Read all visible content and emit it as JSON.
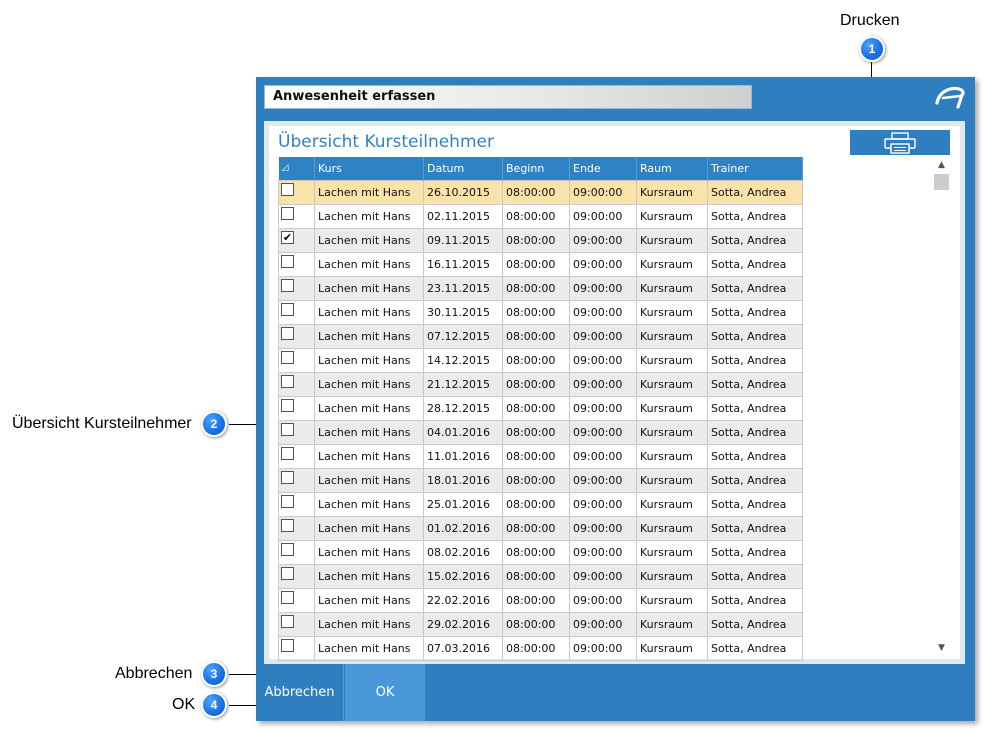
{
  "annotations": [
    {
      "number": "1",
      "label": "Drucken"
    },
    {
      "number": "2",
      "label": "Übersicht Kursteilnehmer"
    },
    {
      "number": "3",
      "label": "Abbrechen"
    },
    {
      "number": "4",
      "label": "OK"
    }
  ],
  "dialog": {
    "title": "Anwesenheit erfassen",
    "panel_title": "Übersicht Kursteilnehmer",
    "icons": {
      "logo": "app-logo-icon",
      "print": "printer-icon",
      "sort": "sort-indicator-icon"
    },
    "colors": {
      "frame": "#2f7fc0",
      "header": "#2f83c5",
      "selected_row": "#fae3a8",
      "alt_row": "#ebebeb"
    }
  },
  "table": {
    "columns": [
      "Kurs",
      "Datum",
      "Beginn",
      "Ende",
      "Raum",
      "Trainer"
    ],
    "rows": [
      {
        "checked": false,
        "kurs": "Lachen mit Hans",
        "datum": "26.10.2015",
        "beginn": "08:00:00",
        "ende": "09:00:00",
        "raum": "Kursraum",
        "trainer": "Sotta, Andrea"
      },
      {
        "checked": false,
        "kurs": "Lachen mit Hans",
        "datum": "02.11.2015",
        "beginn": "08:00:00",
        "ende": "09:00:00",
        "raum": "Kursraum",
        "trainer": "Sotta, Andrea"
      },
      {
        "checked": true,
        "kurs": "Lachen mit Hans",
        "datum": "09.11.2015",
        "beginn": "08:00:00",
        "ende": "09:00:00",
        "raum": "Kursraum",
        "trainer": "Sotta, Andrea"
      },
      {
        "checked": false,
        "kurs": "Lachen mit Hans",
        "datum": "16.11.2015",
        "beginn": "08:00:00",
        "ende": "09:00:00",
        "raum": "Kursraum",
        "trainer": "Sotta, Andrea"
      },
      {
        "checked": false,
        "kurs": "Lachen mit Hans",
        "datum": "23.11.2015",
        "beginn": "08:00:00",
        "ende": "09:00:00",
        "raum": "Kursraum",
        "trainer": "Sotta, Andrea"
      },
      {
        "checked": false,
        "kurs": "Lachen mit Hans",
        "datum": "30.11.2015",
        "beginn": "08:00:00",
        "ende": "09:00:00",
        "raum": "Kursraum",
        "trainer": "Sotta, Andrea"
      },
      {
        "checked": false,
        "kurs": "Lachen mit Hans",
        "datum": "07.12.2015",
        "beginn": "08:00:00",
        "ende": "09:00:00",
        "raum": "Kursraum",
        "trainer": "Sotta, Andrea"
      },
      {
        "checked": false,
        "kurs": "Lachen mit Hans",
        "datum": "14.12.2015",
        "beginn": "08:00:00",
        "ende": "09:00:00",
        "raum": "Kursraum",
        "trainer": "Sotta, Andrea"
      },
      {
        "checked": false,
        "kurs": "Lachen mit Hans",
        "datum": "21.12.2015",
        "beginn": "08:00:00",
        "ende": "09:00:00",
        "raum": "Kursraum",
        "trainer": "Sotta, Andrea"
      },
      {
        "checked": false,
        "kurs": "Lachen mit Hans",
        "datum": "28.12.2015",
        "beginn": "08:00:00",
        "ende": "09:00:00",
        "raum": "Kursraum",
        "trainer": "Sotta, Andrea"
      },
      {
        "checked": false,
        "kurs": "Lachen mit Hans",
        "datum": "04.01.2016",
        "beginn": "08:00:00",
        "ende": "09:00:00",
        "raum": "Kursraum",
        "trainer": "Sotta, Andrea"
      },
      {
        "checked": false,
        "kurs": "Lachen mit Hans",
        "datum": "11.01.2016",
        "beginn": "08:00:00",
        "ende": "09:00:00",
        "raum": "Kursraum",
        "trainer": "Sotta, Andrea"
      },
      {
        "checked": false,
        "kurs": "Lachen mit Hans",
        "datum": "18.01.2016",
        "beginn": "08:00:00",
        "ende": "09:00:00",
        "raum": "Kursraum",
        "trainer": "Sotta, Andrea"
      },
      {
        "checked": false,
        "kurs": "Lachen mit Hans",
        "datum": "25.01.2016",
        "beginn": "08:00:00",
        "ende": "09:00:00",
        "raum": "Kursraum",
        "trainer": "Sotta, Andrea"
      },
      {
        "checked": false,
        "kurs": "Lachen mit Hans",
        "datum": "01.02.2016",
        "beginn": "08:00:00",
        "ende": "09:00:00",
        "raum": "Kursraum",
        "trainer": "Sotta, Andrea"
      },
      {
        "checked": false,
        "kurs": "Lachen mit Hans",
        "datum": "08.02.2016",
        "beginn": "08:00:00",
        "ende": "09:00:00",
        "raum": "Kursraum",
        "trainer": "Sotta, Andrea"
      },
      {
        "checked": false,
        "kurs": "Lachen mit Hans",
        "datum": "15.02.2016",
        "beginn": "08:00:00",
        "ende": "09:00:00",
        "raum": "Kursraum",
        "trainer": "Sotta, Andrea"
      },
      {
        "checked": false,
        "kurs": "Lachen mit Hans",
        "datum": "22.02.2016",
        "beginn": "08:00:00",
        "ende": "09:00:00",
        "raum": "Kursraum",
        "trainer": "Sotta, Andrea"
      },
      {
        "checked": false,
        "kurs": "Lachen mit Hans",
        "datum": "29.02.2016",
        "beginn": "08:00:00",
        "ende": "09:00:00",
        "raum": "Kursraum",
        "trainer": "Sotta, Andrea"
      },
      {
        "checked": false,
        "kurs": "Lachen mit Hans",
        "datum": "07.03.2016",
        "beginn": "08:00:00",
        "ende": "09:00:00",
        "raum": "Kursraum",
        "trainer": "Sotta, Andrea"
      }
    ]
  },
  "footer": {
    "cancel_label": "Abbrechen",
    "ok_label": "OK"
  }
}
